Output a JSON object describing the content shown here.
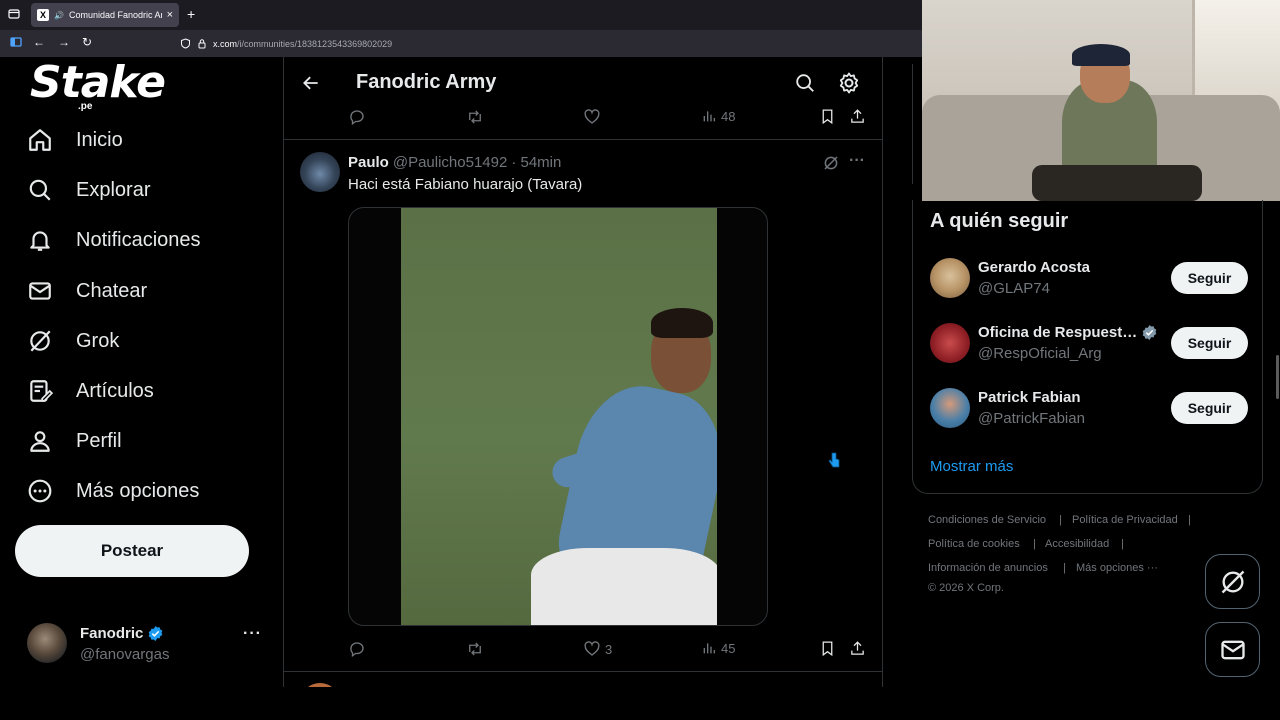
{
  "browser": {
    "tab_title": "Comunidad Fanodric Army",
    "url_host": "x.com",
    "url_path": "/i/communities/1838123543369802029"
  },
  "sidebar": {
    "logo_main": "Stake",
    "logo_sub": ".pe",
    "items": [
      {
        "label": "Inicio",
        "icon": "home-icon"
      },
      {
        "label": "Explorar",
        "icon": "search-icon"
      },
      {
        "label": "Notificaciones",
        "icon": "bell-icon"
      },
      {
        "label": "Chatear",
        "icon": "mail-icon"
      },
      {
        "label": "Grok",
        "icon": "grok-icon"
      },
      {
        "label": "Artículos",
        "icon": "article-icon"
      },
      {
        "label": "Perfil",
        "icon": "user-icon"
      },
      {
        "label": "Más opciones",
        "icon": "more-circle-icon"
      }
    ],
    "post_label": "Postear",
    "account": {
      "name": "Fanodric",
      "handle": "@fanovargas"
    }
  },
  "header": {
    "title": "Fanodric Army"
  },
  "prev_post": {
    "views": "48"
  },
  "post": {
    "author": "Paulo",
    "handle": "@Paulicho51492",
    "time": "· 54min",
    "text": "Haci está Fabiano huarajo (Tavara)",
    "likes": "3",
    "views": "45"
  },
  "who_to_follow": {
    "title": "A quién seguir",
    "follow_label": "Seguir",
    "accounts": [
      {
        "name": "Gerardo Acosta",
        "handle": "@GLAP74",
        "verified": false
      },
      {
        "name": "Oficina de Respuest…",
        "handle": "@RespOficial_Arg",
        "verified": true
      },
      {
        "name": "Patrick Fabian",
        "handle": "@PatrickFabian",
        "verified": false
      }
    ],
    "show_more": "Mostrar más"
  },
  "footer": {
    "links": [
      "Condiciones de Servicio",
      "Política de Privacidad",
      "Política de cookies",
      "Accesibilidad",
      "Información de anuncios",
      "Más opciones ···"
    ],
    "copyright": "© 2026 X Corp."
  },
  "colors": {
    "accent": "#1d9bf0",
    "bg": "#000000",
    "border": "#2f3336",
    "muted": "#71767b"
  }
}
